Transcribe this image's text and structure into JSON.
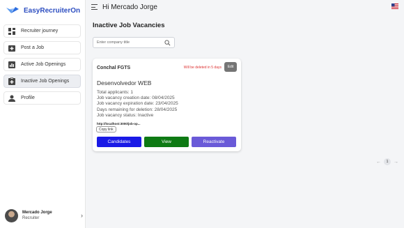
{
  "brand": {
    "name": "EasyRecruiterOn",
    "logo_color": "#3a7bd5"
  },
  "sidebar": {
    "items": [
      {
        "label": "Recruiter journey",
        "icon": "dashboard-icon",
        "active": false
      },
      {
        "label": "Post a Job",
        "icon": "add-box-icon",
        "active": false
      },
      {
        "label": "Active Job Openings",
        "icon": "chart-icon",
        "active": false
      },
      {
        "label": "Inactive Job Openings",
        "icon": "clipboard-icon",
        "active": true
      },
      {
        "label": "Profile",
        "icon": "person-icon",
        "active": false
      }
    ],
    "user": {
      "name": "Mercado Jorge",
      "role": "Recruiter"
    }
  },
  "header": {
    "greeting": "Hi Mercado Jorge",
    "flag": "us-flag-icon"
  },
  "page": {
    "title": "Inactive Job Vacancies"
  },
  "search": {
    "placeholder": "Enter company title",
    "value": ""
  },
  "card": {
    "company": "Conchal FGTS",
    "deletion_warning": "Will be deleted in 5 days",
    "edit_label": "Edit",
    "job_title": "Desenvolvedor WEB",
    "details": [
      "Total applicants: 1",
      "Job vacancy creation date: 08/04/2025",
      "Job vacancy expiration date: 23/04/2025",
      "Days remaining for deletion: 28/04/2025",
      "Job vacancy status: Inactive"
    ],
    "link": "http://localhost:3000/job-op...",
    "copy_label": "Copy link",
    "buttons": {
      "candidates": "Candidates",
      "view": "View",
      "reactivate": "Reactivate"
    }
  },
  "pagination": {
    "current": "1",
    "prev": "←",
    "next": "→"
  },
  "colors": {
    "accent": "#2d4ec1",
    "candidates": "#1a1ae6",
    "view": "#0e7a14",
    "reactivate": "#6a5ad8",
    "warning": "#dd3333"
  }
}
